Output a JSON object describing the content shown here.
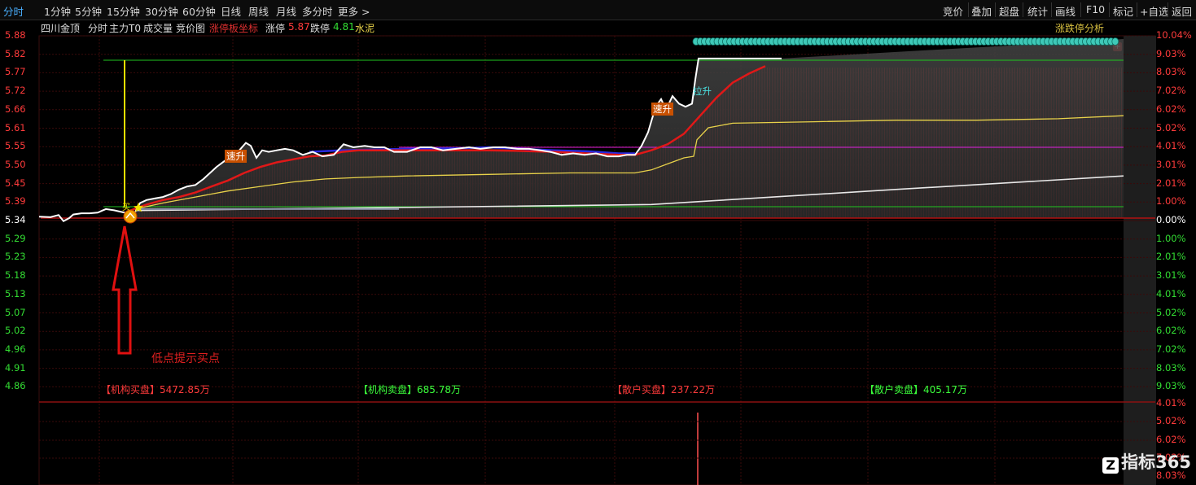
{
  "topbar": {
    "tabs": [
      "分时",
      "1分钟",
      "5分钟",
      "15分钟",
      "30分钟",
      "60分钟",
      "日线",
      "周线",
      "月线",
      "多分时",
      "更多 >"
    ],
    "active_tab": "分时",
    "right_buttons": [
      "竞价",
      "叠加",
      "超盘",
      "统计",
      "画线",
      "F10",
      "标记",
      "+自选",
      "返回"
    ]
  },
  "infobar": {
    "stock_name": "四川金顶",
    "items": [
      "分时",
      "主力T0",
      "成交量",
      "竞价图"
    ],
    "limit_coord_label": "涨停板坐标",
    "limit_up_label": "涨停",
    "limit_up_value": "5.87",
    "limit_down_label": "跌停",
    "limit_down_value": "4.81",
    "sector": "水泥",
    "analysis_button": "涨跌停分析"
  },
  "axis": {
    "price_labels": [
      "5.88",
      "5.82",
      "5.77",
      "5.72",
      "5.66",
      "5.61",
      "5.55",
      "5.50",
      "5.45",
      "5.39",
      "5.34",
      "5.29",
      "5.23",
      "5.18",
      "5.13",
      "5.07",
      "5.02",
      "4.96",
      "4.91",
      "4.86"
    ],
    "pct_labels": [
      "10.04%",
      "9.03%",
      "8.03%",
      "7.02%",
      "6.02%",
      "5.02%",
      "4.01%",
      "3.01%",
      "2.01%",
      "1.00%",
      "0.00%",
      "1.00%",
      "2.01%",
      "3.01%",
      "4.01%",
      "5.02%",
      "6.02%",
      "7.02%",
      "8.03%",
      "9.03%",
      "4.01%",
      "5.02%",
      "6.02%",
      "7.02%",
      "8.03%"
    ],
    "base_price": 5.34
  },
  "annotations": {
    "fast_rise_1": "速升",
    "fast_rise_2": "速升",
    "pull_up": "拉升",
    "buy_tag": "买",
    "low_point_hint": "低点提示买点"
  },
  "flows": [
    {
      "label": "【机构买盘】",
      "value": "5472.85万",
      "color": "#ff3b3b"
    },
    {
      "label": "【机构卖盘】",
      "value": "685.78万",
      "color": "#3bff3b"
    },
    {
      "label": "【散户买盘】",
      "value": "237.22万",
      "color": "#ff3b3b"
    },
    {
      "label": "【散户卖盘】",
      "value": "405.17万",
      "color": "#3bff3b"
    }
  ],
  "watermark": "指标365",
  "colors": {
    "up": "#ff3b3b",
    "down": "#33dd33",
    "active_tab": "#4ab0ff",
    "price_line": "#ffffff",
    "avg_line": "#e8d24a",
    "main_line": "#e01818",
    "limit_marker": "#3ec9b8"
  }
}
